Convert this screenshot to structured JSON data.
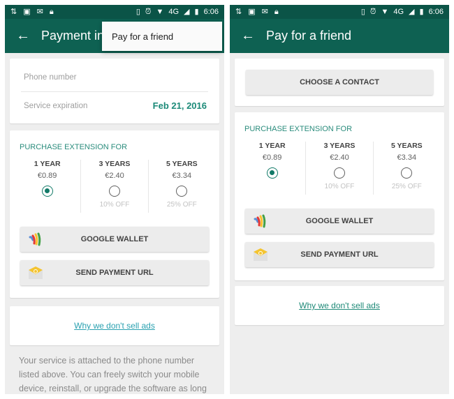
{
  "status_bar": {
    "time": "6:06",
    "network": "4G",
    "left_icons": [
      "retweet-icon",
      "image-icon",
      "gmail-icon",
      "lock-icon"
    ],
    "right_icons": [
      "vibrate-icon",
      "alarm-icon",
      "wifi-icon",
      "signal-icon",
      "battery-icon"
    ]
  },
  "left_screen": {
    "title": "Payment in",
    "overflow_menu": {
      "items": [
        {
          "label": "Pay for a friend"
        }
      ]
    },
    "info_card": {
      "phone_label": "Phone number",
      "phone_value": "",
      "expiration_label": "Service expiration",
      "expiration_value": "Feb 21, 2016"
    },
    "purchase": {
      "section_label": "PURCHASE EXTENSION FOR",
      "plans": [
        {
          "name": "1 YEAR",
          "price": "€0.89",
          "discount": "",
          "selected": true
        },
        {
          "name": "3 YEARS",
          "price": "€2.40",
          "discount": "10% OFF",
          "selected": false
        },
        {
          "name": "5 YEARS",
          "price": "€3.34",
          "discount": "25% OFF",
          "selected": false
        }
      ],
      "google_wallet_label": "GOOGLE WALLET",
      "send_url_label": "SEND PAYMENT URL"
    },
    "ads_link": "Why we don't sell ads",
    "footer_text": "Your service is attached to the phone number listed above. You can freely switch your mobile device, reinstall, or upgrade the software as long"
  },
  "right_screen": {
    "title": "Pay for a friend",
    "choose_contact_label": "CHOOSE A CONTACT",
    "purchase": {
      "section_label": "PURCHASE EXTENSION FOR",
      "plans": [
        {
          "name": "1 YEAR",
          "price": "€0.89",
          "discount": "",
          "selected": true
        },
        {
          "name": "3 YEARS",
          "price": "€2.40",
          "discount": "10% OFF",
          "selected": false
        },
        {
          "name": "5 YEARS",
          "price": "€3.34",
          "discount": "25% OFF",
          "selected": false
        }
      ],
      "google_wallet_label": "GOOGLE WALLET",
      "send_url_label": "SEND PAYMENT URL"
    },
    "ads_link": "Why we don't sell ads"
  },
  "colors": {
    "status_bar": "#0b5447",
    "toolbar": "#0e6152",
    "accent": "#127a68",
    "link": "#2aa1b0"
  }
}
